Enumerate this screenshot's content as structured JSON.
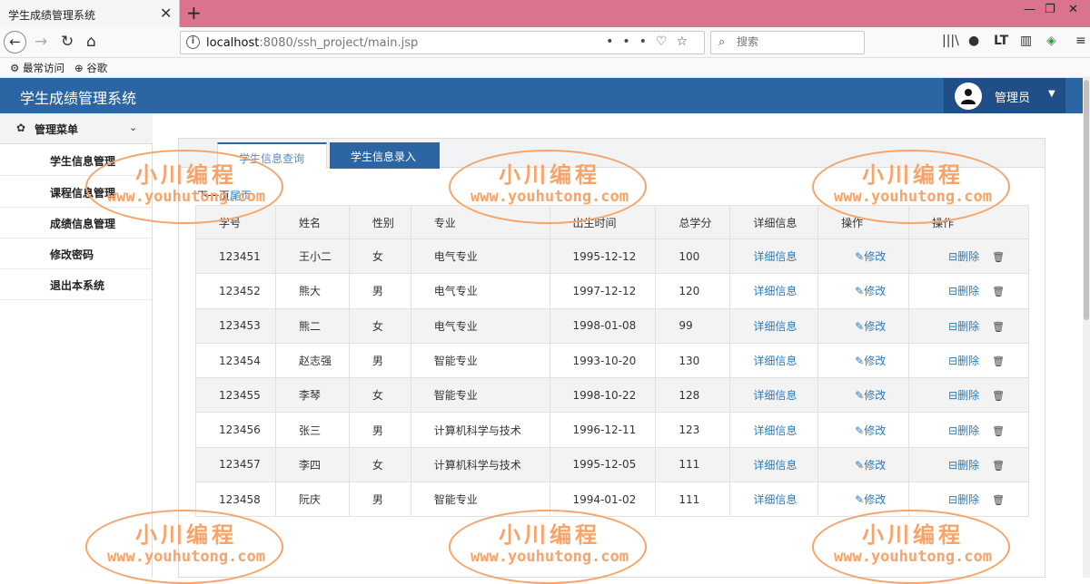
{
  "browser": {
    "tab_title": "学生成绩管理系统",
    "tab_close": "✕",
    "new_tab": "+",
    "url_host": "localhost",
    "url_path": ":8080/ssh_project/main.jsp",
    "url_tools": "•••",
    "search_placeholder": "搜索",
    "bookmarks": [
      "最常访问",
      "谷歌"
    ]
  },
  "app": {
    "title": "学生成绩管理系统",
    "user": "管理员"
  },
  "sidebar": {
    "header": "管理菜单",
    "items": [
      {
        "label": "学生信息管理"
      },
      {
        "label": "课程信息管理"
      },
      {
        "label": "成绩信息管理"
      },
      {
        "label": "修改密码"
      },
      {
        "label": "退出本系统"
      }
    ]
  },
  "tabs": [
    {
      "label": "学生信息查询",
      "active": true
    },
    {
      "label": "学生信息录入",
      "active": false
    }
  ],
  "pager": {
    "next": "下一页",
    "last": "尾页"
  },
  "table": {
    "columns": [
      "学号",
      "姓名",
      "性别",
      "专业",
      "出生时间",
      "总学分",
      "详细信息",
      "操作",
      "操作"
    ],
    "detail_label": "详细信息",
    "edit_label": "修改",
    "delete_label": "删除",
    "rows": [
      {
        "id": "123451",
        "name": "王小二",
        "sex": "女",
        "major": "电气专业",
        "birth": "1995-12-12",
        "credits": "100"
      },
      {
        "id": "123452",
        "name": "熊大",
        "sex": "男",
        "major": "电气专业",
        "birth": "1997-12-12",
        "credits": "120"
      },
      {
        "id": "123453",
        "name": "熊二",
        "sex": "女",
        "major": "电气专业",
        "birth": "1998-01-08",
        "credits": "99"
      },
      {
        "id": "123454",
        "name": "赵志强",
        "sex": "男",
        "major": "智能专业",
        "birth": "1993-10-20",
        "credits": "130"
      },
      {
        "id": "123455",
        "name": "李琴",
        "sex": "女",
        "major": "智能专业",
        "birth": "1998-10-22",
        "credits": "128"
      },
      {
        "id": "123456",
        "name": "张三",
        "sex": "男",
        "major": "计算机科学与技术",
        "birth": "1996-12-11",
        "credits": "123"
      },
      {
        "id": "123457",
        "name": "李四",
        "sex": "女",
        "major": "计算机科学与技术",
        "birth": "1995-12-05",
        "credits": "111"
      },
      {
        "id": "123458",
        "name": "阮庆",
        "sex": "男",
        "major": "智能专业",
        "birth": "1994-01-02",
        "credits": "111"
      }
    ]
  },
  "watermark": {
    "cn": "小川编程",
    "en": "www.youhutong.com"
  },
  "colors": {
    "header": "#2b65a3",
    "link": "#2a7ab8",
    "watermark": "#f6a46a",
    "tabbar": "#d9738e"
  }
}
